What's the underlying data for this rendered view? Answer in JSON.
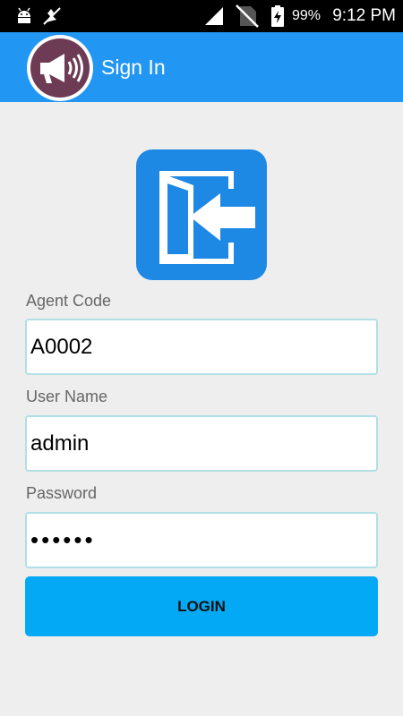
{
  "status_bar": {
    "battery_percent": "99%",
    "time": "9:12 PM",
    "icons": [
      "android-debug-icon",
      "missed-call-icon",
      "signal-icon",
      "no-sim-icon",
      "battery-charging-icon"
    ]
  },
  "app_bar": {
    "title": "Sign In",
    "logo_icon": "megaphone-icon",
    "background_color": "#2196f3"
  },
  "login_icon": "sign-in-door-arrow-icon",
  "form": {
    "agent_code": {
      "label": "Agent Code",
      "value": "A0002"
    },
    "user_name": {
      "label": "User Name",
      "value": "admin"
    },
    "password": {
      "label": "Password",
      "value": "••••••"
    }
  },
  "login_button": {
    "label": "LOGIN",
    "color": "#03a9f4"
  }
}
